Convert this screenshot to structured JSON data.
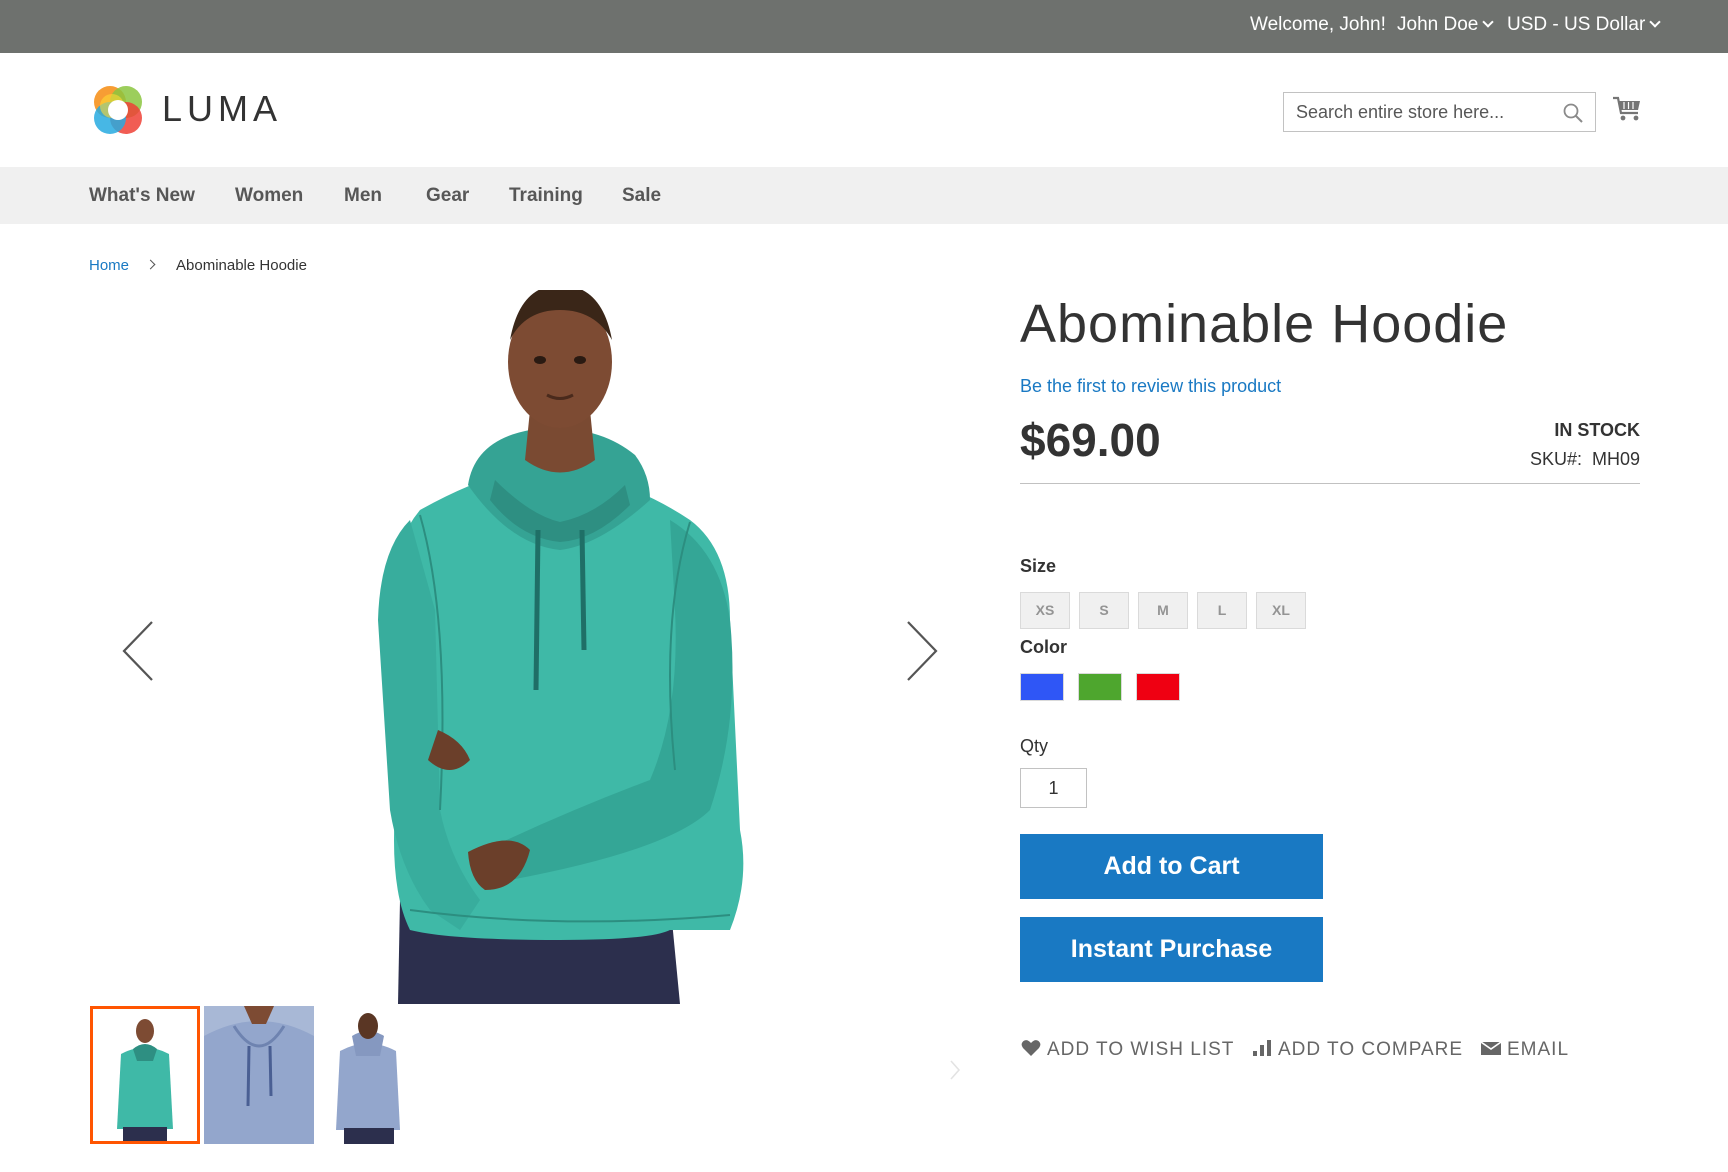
{
  "top_panel": {
    "welcome": "Welcome, John!",
    "account": "John Doe",
    "currency": "USD - US Dollar"
  },
  "header": {
    "logo_text": "LUMA",
    "search_placeholder": "Search entire store here...",
    "icons": [
      "luma-logo-icon",
      "search-icon",
      "cart-icon"
    ]
  },
  "nav": {
    "items": [
      {
        "label": "What's New"
      },
      {
        "label": "Women"
      },
      {
        "label": "Men"
      },
      {
        "label": "Gear"
      },
      {
        "label": "Training"
      },
      {
        "label": "Sale"
      }
    ]
  },
  "breadcrumb": {
    "home": "Home",
    "current": "Abominable Hoodie"
  },
  "gallery": {
    "selected_thumbnail": 1,
    "thumbnail_count": 3,
    "hoodie_color": "#3fb9a7"
  },
  "product": {
    "title": "Abominable Hoodie",
    "review_link": "Be the first to review this product",
    "price": "$69.00",
    "stock": "IN STOCK",
    "sku_label": "SKU#:",
    "sku": "MH09",
    "size_label": "Size",
    "sizes": [
      "XS",
      "S",
      "M",
      "L",
      "XL"
    ],
    "color_label": "Color",
    "colors": [
      "#2f56f6",
      "#4ea62e",
      "#ef0012"
    ],
    "qty_label": "Qty",
    "qty": "1",
    "add_to_cart": "Add to Cart",
    "instant_purchase": "Instant Purchase",
    "actions": {
      "wishlist": "ADD TO WISH LIST",
      "compare": "ADD TO COMPARE",
      "email": "EMAIL"
    }
  },
  "colors": {
    "panel_bg": "#6e716e",
    "link": "#1979c3",
    "button": "#1979c3",
    "nav_bg": "#f0f0f0",
    "active_thumb_border": "#ff5501"
  }
}
